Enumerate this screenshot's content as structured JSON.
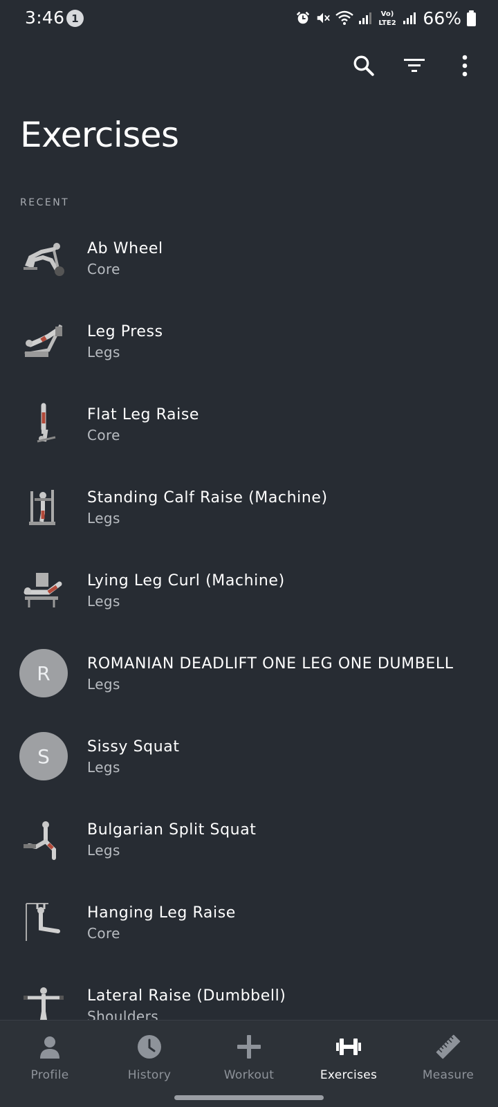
{
  "status_bar": {
    "time": "3:46",
    "notification_count": "1",
    "network_label": "Vo) LTE2",
    "battery_percent": "66%"
  },
  "toolbar": {
    "icons": [
      "search-icon",
      "filter-icon",
      "more-vert-icon"
    ]
  },
  "page": {
    "title": "Exercises",
    "section_label": "RECENT"
  },
  "exercises": [
    {
      "name": "Ab Wheel",
      "category": "Core",
      "thumb": "ab-wheel-figure"
    },
    {
      "name": "Leg Press",
      "category": "Legs",
      "thumb": "leg-press-figure"
    },
    {
      "name": "Flat Leg Raise",
      "category": "Core",
      "thumb": "flat-leg-raise-figure"
    },
    {
      "name": "Standing Calf Raise (Machine)",
      "category": "Legs",
      "thumb": "calf-raise-machine-figure"
    },
    {
      "name": "Lying Leg Curl (Machine)",
      "category": "Legs",
      "thumb": "leg-curl-machine-figure"
    },
    {
      "name": "ROMANIAN DEADLIFT ONE LEG ONE DUMBELL",
      "category": "Legs",
      "avatar_letter": "R"
    },
    {
      "name": "Sissy Squat",
      "category": "Legs",
      "avatar_letter": "S"
    },
    {
      "name": "Bulgarian Split Squat",
      "category": "Legs",
      "thumb": "split-squat-figure"
    },
    {
      "name": "Hanging Leg Raise",
      "category": "Core",
      "thumb": "hanging-leg-raise-figure"
    },
    {
      "name": "Lateral Raise (Dumbbell)",
      "category": "Shoulders",
      "thumb": "lateral-raise-figure"
    }
  ],
  "bottom_nav": [
    {
      "label": "Profile",
      "icon": "person-icon",
      "active": false
    },
    {
      "label": "History",
      "icon": "clock-icon",
      "active": false
    },
    {
      "label": "Workout",
      "icon": "plus-icon",
      "active": false
    },
    {
      "label": "Exercises",
      "icon": "dumbbell-icon",
      "active": true
    },
    {
      "label": "Measure",
      "icon": "ruler-icon",
      "active": false
    }
  ],
  "colors": {
    "background": "#272c33",
    "nav_background": "#2d3238",
    "text_primary": "#ffffff",
    "text_secondary": "#b8bcc1",
    "nav_inactive": "#8e939a",
    "avatar_bg": "#9ea0a3"
  }
}
